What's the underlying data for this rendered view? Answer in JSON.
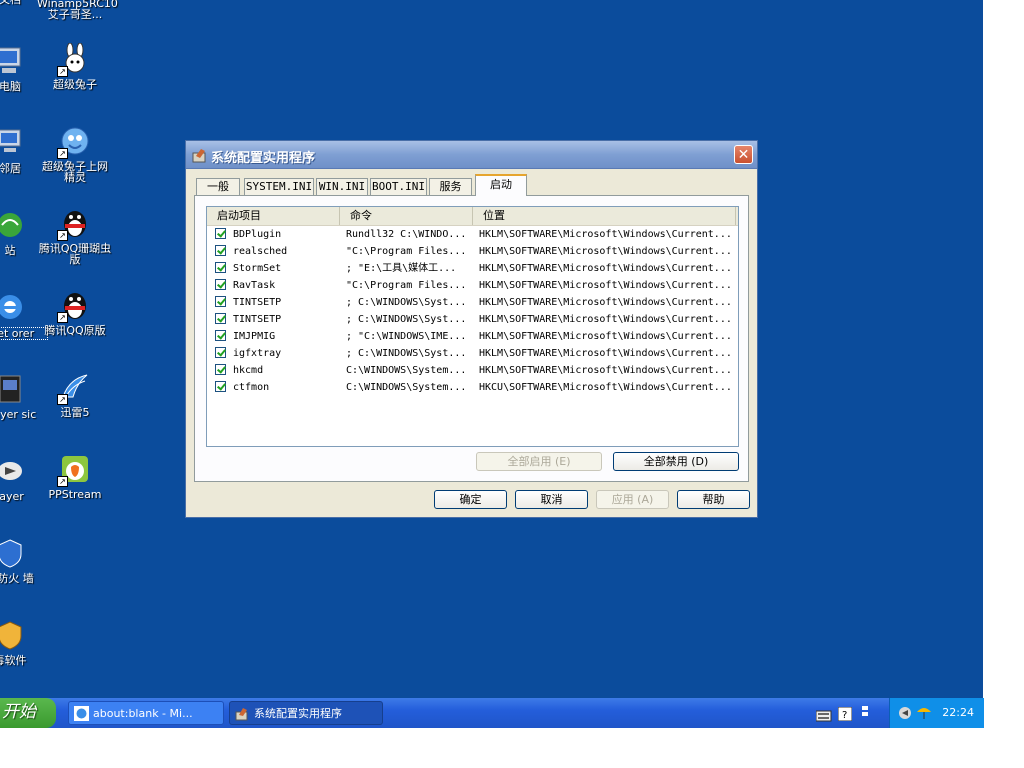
{
  "desktop": {
    "icons": [
      {
        "label": "文档"
      },
      {
        "label": "Winamp5RC10 艾子哥圣..."
      },
      {
        "label": "电脑"
      },
      {
        "label": "超级兔子"
      },
      {
        "label": "邻居"
      },
      {
        "label": "超级兔子上网精灵"
      },
      {
        "label": "站"
      },
      {
        "label": "腾讯QQ珊瑚虫版"
      },
      {
        "label": "rnet orer"
      },
      {
        "label": "腾讯QQ原版"
      },
      {
        "label": "Player sic"
      },
      {
        "label": "迅雷5"
      },
      {
        "label": "layer"
      },
      {
        "label": "PPStream"
      },
      {
        "label": "人防火 墙"
      },
      {
        "label": "毒软件"
      }
    ]
  },
  "dialog": {
    "title": "系统配置实用程序",
    "close_label": "✕",
    "tabs": [
      {
        "label": "一般"
      },
      {
        "label": "SYSTEM.INI"
      },
      {
        "label": "WIN.INI"
      },
      {
        "label": "BOOT.INI"
      },
      {
        "label": "服务"
      },
      {
        "label": "启动"
      }
    ],
    "columns": {
      "item": "启动项目",
      "command": "命令",
      "location": "位置"
    },
    "rows": [
      {
        "name": "BDPlugin",
        "command": "Rundll32 C:\\WINDO...",
        "location": "HKLM\\SOFTWARE\\Microsoft\\Windows\\Current..."
      },
      {
        "name": "realsched",
        "command": "\"C:\\Program Files...",
        "location": "HKLM\\SOFTWARE\\Microsoft\\Windows\\Current..."
      },
      {
        "name": "StormSet",
        "command": "; \"E:\\工具\\媒体工...",
        "location": "HKLM\\SOFTWARE\\Microsoft\\Windows\\Current..."
      },
      {
        "name": "RavTask",
        "command": "\"C:\\Program Files...",
        "location": "HKLM\\SOFTWARE\\Microsoft\\Windows\\Current..."
      },
      {
        "name": "TINTSETP",
        "command": "; C:\\WINDOWS\\Syst...",
        "location": "HKLM\\SOFTWARE\\Microsoft\\Windows\\Current..."
      },
      {
        "name": "TINTSETP",
        "command": "; C:\\WINDOWS\\Syst...",
        "location": "HKLM\\SOFTWARE\\Microsoft\\Windows\\Current..."
      },
      {
        "name": "IMJPMIG",
        "command": "; \"C:\\WINDOWS\\IME...",
        "location": "HKLM\\SOFTWARE\\Microsoft\\Windows\\Current..."
      },
      {
        "name": "igfxtray",
        "command": "; C:\\WINDOWS\\Syst...",
        "location": "HKLM\\SOFTWARE\\Microsoft\\Windows\\Current..."
      },
      {
        "name": "hkcmd",
        "command": "C:\\WINDOWS\\System...",
        "location": "HKLM\\SOFTWARE\\Microsoft\\Windows\\Current..."
      },
      {
        "name": "ctfmon",
        "command": "C:\\WINDOWS\\System...",
        "location": "HKCU\\SOFTWARE\\Microsoft\\Windows\\Current..."
      }
    ],
    "buttons": {
      "enable_all": "全部启用 (E)",
      "disable_all": "全部禁用 (D)",
      "ok": "确定",
      "cancel": "取消",
      "apply": "应用 (A)",
      "help": "帮助"
    }
  },
  "taskbar": {
    "start_label": "开始",
    "tasks": [
      {
        "label": "about:blank - Mi..."
      },
      {
        "label": "系统配置实用程序"
      }
    ],
    "clock": "22:24"
  }
}
